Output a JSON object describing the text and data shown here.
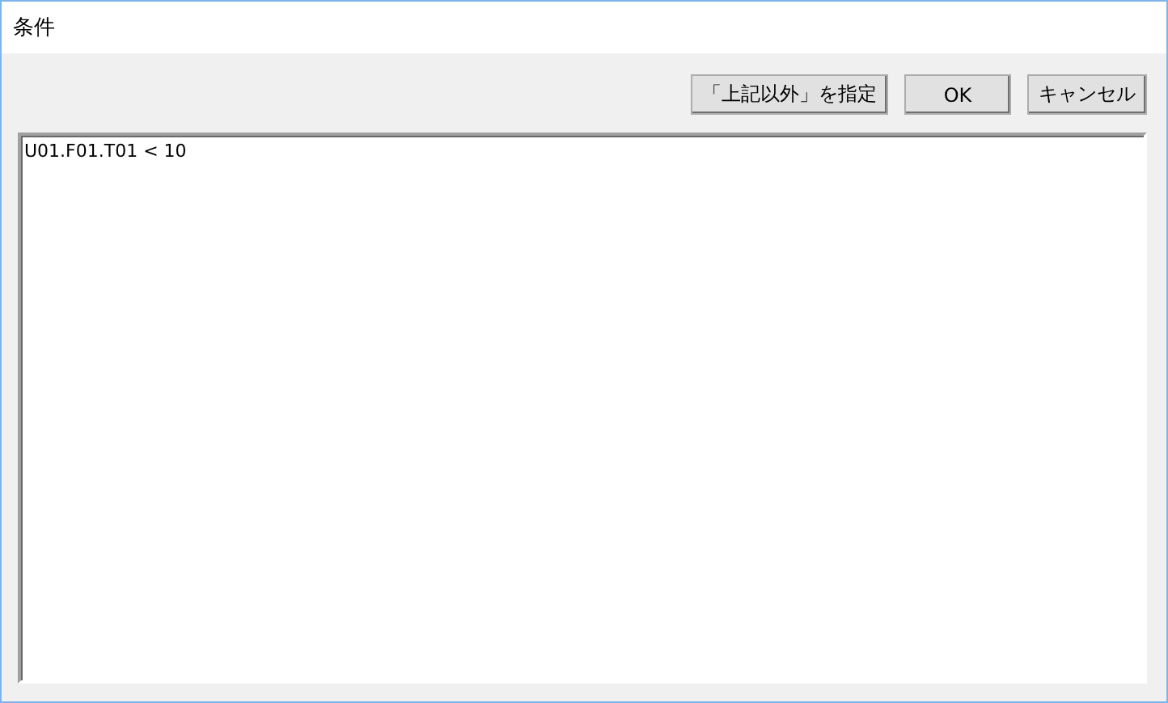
{
  "window": {
    "title": "条件"
  },
  "buttons": [
    {
      "label": "「上記以外」を指定"
    },
    {
      "label": "OK"
    },
    {
      "label": "キャンセル"
    }
  ],
  "editor": {
    "value": "U01.F01.T01 < 10"
  }
}
